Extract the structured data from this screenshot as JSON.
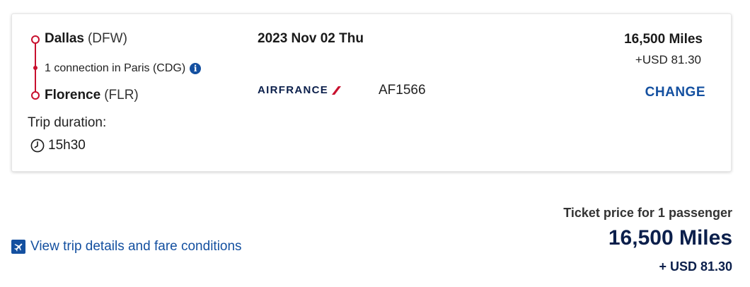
{
  "colors": {
    "route_line": "#c8102e",
    "link_blue": "#1450a0",
    "navy": "#0b1f4b"
  },
  "flight": {
    "origin_city": "Dallas",
    "origin_code": "(DFW)",
    "connection_text": "1 connection in Paris (CDG)",
    "destination_city": "Florence",
    "destination_code": "(FLR)",
    "duration_label": "Trip duration:",
    "duration": "15h30",
    "date": "2023 Nov 02 Thu",
    "airline_name": "AIRFRANCE",
    "flight_number": "AF1566",
    "miles": "16,500 Miles",
    "usd": "+USD 81.30",
    "change_label": "CHANGE"
  },
  "icons": {
    "info": "info-icon",
    "clock": "clock-icon",
    "plane": "plane-icon"
  },
  "summary": {
    "details_link": "View trip details and fare conditions",
    "ticket_label": "Ticket price for 1 passenger",
    "miles": "16,500 Miles",
    "usd": "+ USD 81.30"
  }
}
